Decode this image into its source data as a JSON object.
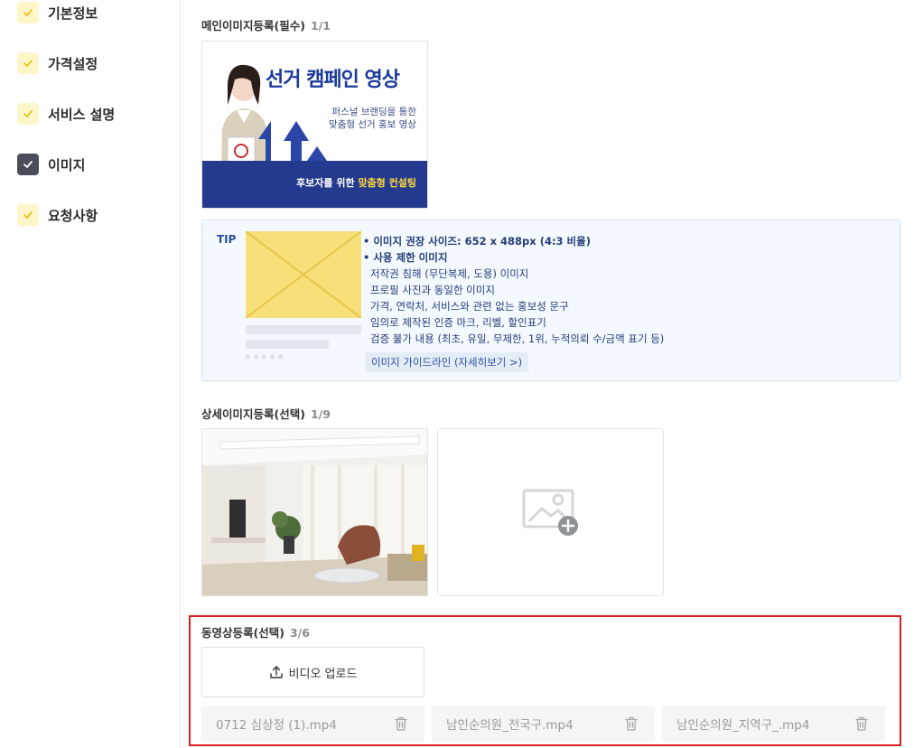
{
  "sidebar": {
    "items": [
      {
        "label": "기본정보",
        "checked": true,
        "active": false
      },
      {
        "label": "가격설정",
        "checked": true,
        "active": false
      },
      {
        "label": "서비스 설명",
        "checked": true,
        "active": false
      },
      {
        "label": "이미지",
        "checked": true,
        "active": true
      },
      {
        "label": "요청사항",
        "checked": true,
        "active": false
      }
    ]
  },
  "main_image": {
    "title": "메인이미지등록(필수)",
    "count": "1/1",
    "banner": {
      "headline": "선거 캠페인 영상",
      "sub1": "퍼스널 브랜딩을 통한",
      "sub2": "맞춤형 선거 홍보 영상",
      "band_text_prefix": "후보자를 위한 ",
      "band_text_highlight": "맞춤형 컨설팅"
    }
  },
  "tip": {
    "label": "TIP",
    "lines": [
      "• 이미지 권장 사이즈: 652 x 488px (4:3 비율)",
      "• 사용 제한 이미지",
      "저작권 침해 (무단복제, 도용) 이미지",
      "프로필 사진과 동일한 이미지",
      "가격, 연락처, 서비스와 관련 없는 홍보성 문구",
      "임의로 제작된 인증 마크, 리벨, 할인표기",
      "검증 불가 내용 (최초, 유일, 무제한, 1위, 누적의뢰 수/금액 표기 등)"
    ],
    "stars": "★★★★★",
    "guide_button": "이미지 가이드라인 (자세히보기 >)"
  },
  "detail_image": {
    "title": "상세이미지등록(선택)",
    "count": "1/9"
  },
  "video": {
    "title": "동영상등록(선택)",
    "count": "3/6",
    "upload_label": "비디오 업로드",
    "files": [
      "0712 심상정 (1).mp4",
      "남인순의원_전국구.mp4",
      "남인순의원_지역구_.mp4"
    ]
  },
  "colors": {
    "check_bg": "#fdf6c9",
    "check_mark": "#e8c21a",
    "active_bg": "#4a4e5a",
    "highlight_frame": "#d62020",
    "tip_bg": "#f4f9ff"
  }
}
